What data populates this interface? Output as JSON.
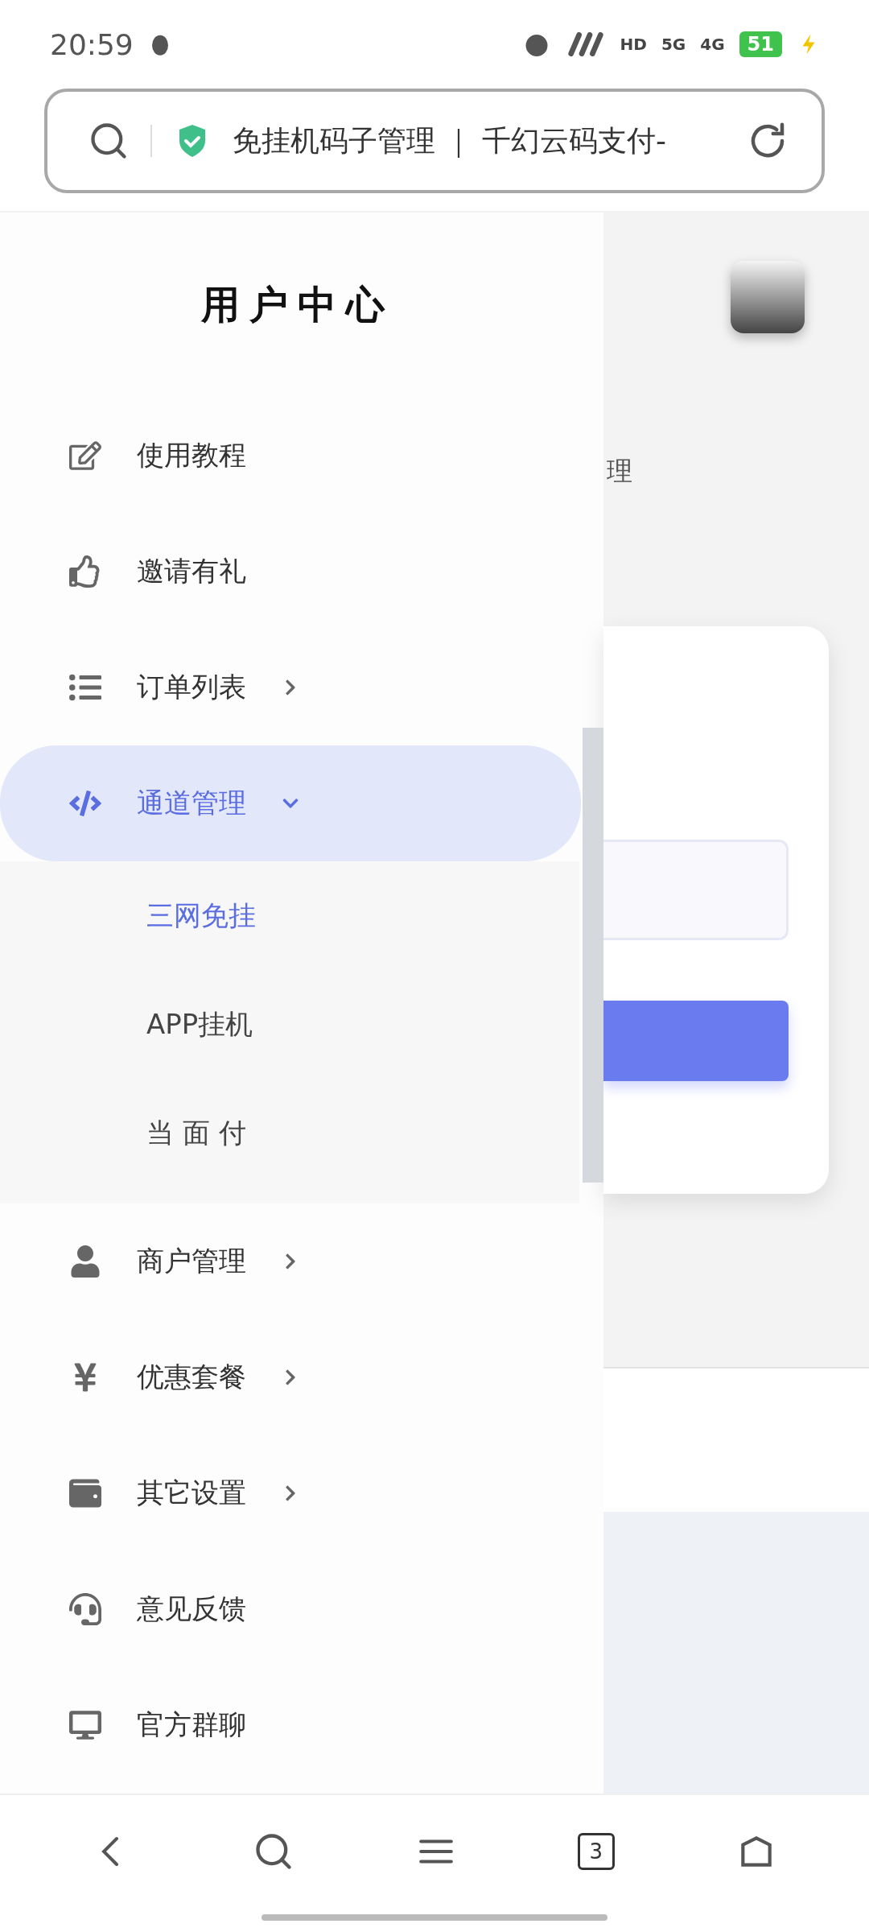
{
  "status_bar": {
    "time": "20:59",
    "network_labels": [
      "HD",
      "5G",
      "4G"
    ],
    "battery": "51"
  },
  "address_bar": {
    "title": "免挂机码子管理 ｜ 千幻云码支付-"
  },
  "drawer": {
    "title": "用户中心",
    "items": [
      {
        "label": "使用教程",
        "kind": "link",
        "selected": false
      },
      {
        "label": "邀请有礼",
        "kind": "link",
        "selected": false
      },
      {
        "label": "订单列表",
        "kind": "collapsed",
        "selected": false
      },
      {
        "label": "通道管理",
        "kind": "expanded",
        "selected": true,
        "children": [
          {
            "label": "三网免挂",
            "selected": true
          },
          {
            "label": "APP挂机",
            "selected": false
          },
          {
            "label": "当 面 付",
            "selected": false
          }
        ]
      },
      {
        "label": "商户管理",
        "kind": "collapsed",
        "selected": false
      },
      {
        "label": "优惠套餐",
        "kind": "collapsed",
        "selected": false
      },
      {
        "label": "其它设置",
        "kind": "collapsed",
        "selected": false
      },
      {
        "label": "意见反馈",
        "kind": "link",
        "selected": false
      },
      {
        "label": "官方群聊",
        "kind": "link",
        "selected": false
      }
    ]
  },
  "page": {
    "heading_fragment": "理"
  },
  "bottom_nav": {
    "tab_count": "3"
  }
}
